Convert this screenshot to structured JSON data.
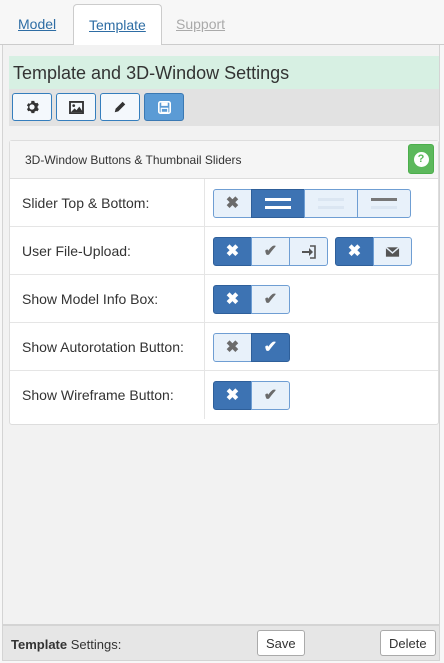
{
  "tabs": {
    "model": "Model",
    "template": "Template",
    "support": "Support"
  },
  "header": {
    "title": "Template and 3D-Window Settings"
  },
  "toolbar": [
    "gear-icon",
    "image-icon",
    "pencil-icon",
    "save-icon"
  ],
  "panel": {
    "title": "3D-Window Buttons & Thumbnail Sliders",
    "help": "?",
    "rows": [
      {
        "label": "Slider Top & Bottom:",
        "selected": "top-and-bottom"
      },
      {
        "label": "User File-Upload:",
        "upload": "off",
        "email": "off"
      },
      {
        "label": "Show Model Info Box:",
        "selected": "off"
      },
      {
        "label": "Show Autorotation Button:",
        "selected": "on"
      },
      {
        "label": "Show Wireframe Button:",
        "selected": "off"
      }
    ]
  },
  "footer": {
    "label_bold": "Template",
    "label_rest": " Settings:",
    "save": "Save",
    "delete": "Delete"
  },
  "colors": {
    "accent": "#3d73b3",
    "title_bg": "#d7f0e3",
    "help": "#5cb85c"
  }
}
